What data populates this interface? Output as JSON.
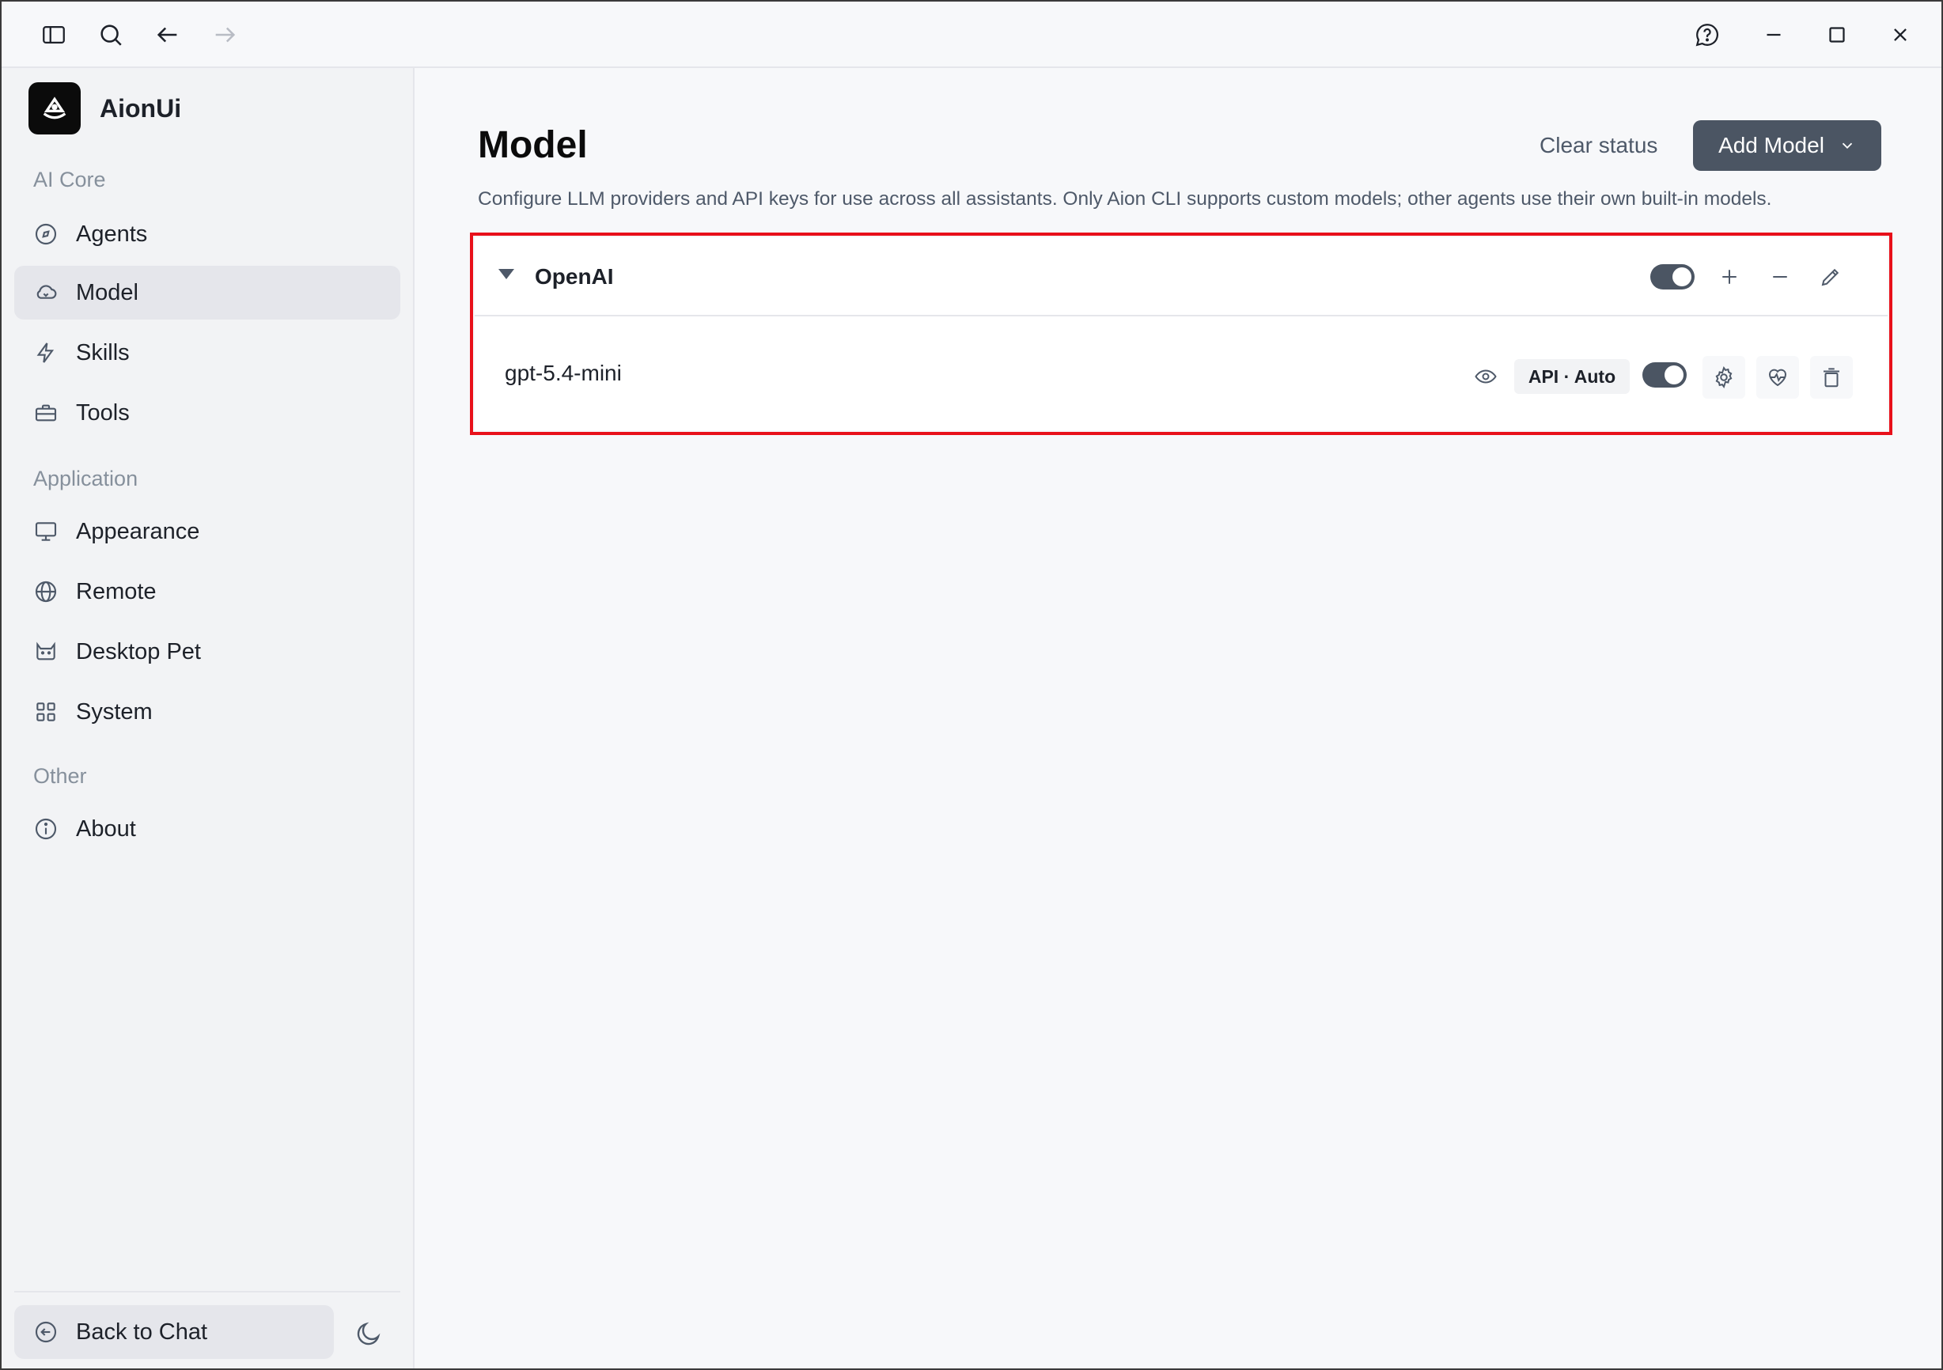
{
  "app": {
    "name": "AionUi"
  },
  "sidebar": {
    "sections": {
      "ai_core": "AI Core",
      "application": "Application",
      "other": "Other"
    },
    "items": [
      {
        "label": "Agents",
        "icon": "compass-icon"
      },
      {
        "label": "Model",
        "icon": "cloud-icon",
        "active": true
      },
      {
        "label": "Skills",
        "icon": "lightning-icon"
      },
      {
        "label": "Tools",
        "icon": "toolbox-icon"
      },
      {
        "label": "Appearance",
        "icon": "monitor-icon"
      },
      {
        "label": "Remote",
        "icon": "globe-icon"
      },
      {
        "label": "Desktop Pet",
        "icon": "cat-icon"
      },
      {
        "label": "System",
        "icon": "grid-icon"
      },
      {
        "label": "About",
        "icon": "info-icon"
      }
    ],
    "back_to_chat": "Back to Chat"
  },
  "main": {
    "title": "Model",
    "clear_status": "Clear status",
    "add_model": "Add Model",
    "description": "Configure LLM providers and API keys for use across all assistants. Only Aion CLI supports custom models; other agents use their own built-in models.",
    "provider": {
      "name": "OpenAI",
      "enabled": true,
      "models": [
        {
          "name": "gpt-5.4-mini",
          "badge": "API · Auto",
          "enabled": true
        }
      ]
    }
  },
  "colors": {
    "accent": "#4b5563",
    "highlight": "#e8101a",
    "sidebar_bg": "#f2f3f5",
    "main_bg": "#f7f8fa"
  }
}
